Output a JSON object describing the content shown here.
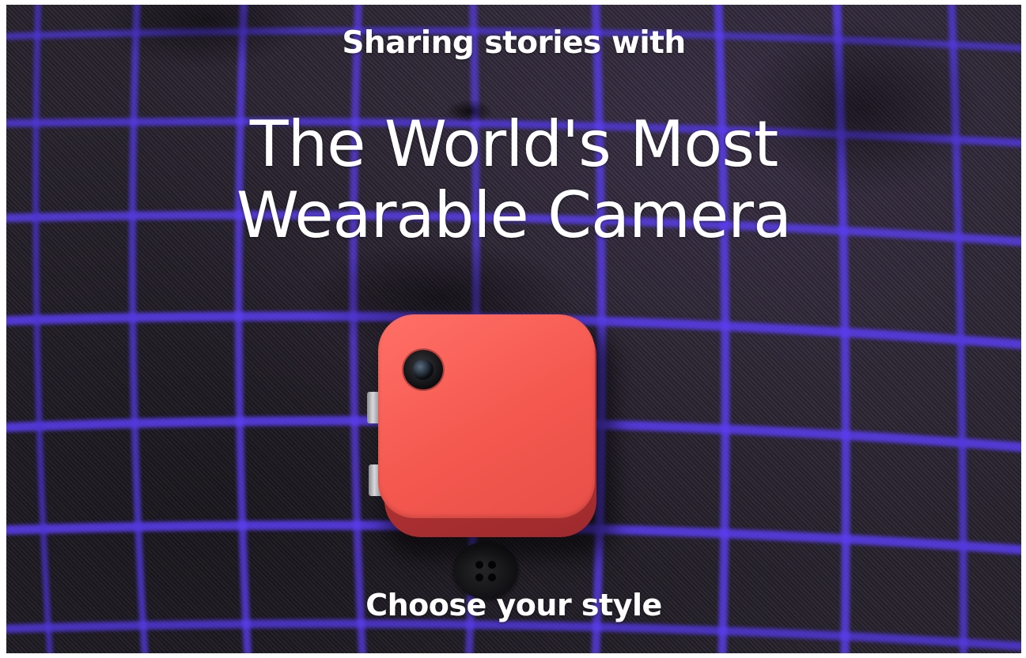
{
  "hero": {
    "background_image": "purple-plaid-shirt-with-orange-wearable-camera",
    "subtitle": "Sharing stories with",
    "title_line1": "The World's Most",
    "title_line2": "Wearable Camera",
    "cta_label": "Choose your style"
  },
  "colors": {
    "fabric": "#2a2530",
    "plaid_line": "#5b3df0",
    "camera_body": "#f4584f",
    "text": "#ffffff"
  }
}
